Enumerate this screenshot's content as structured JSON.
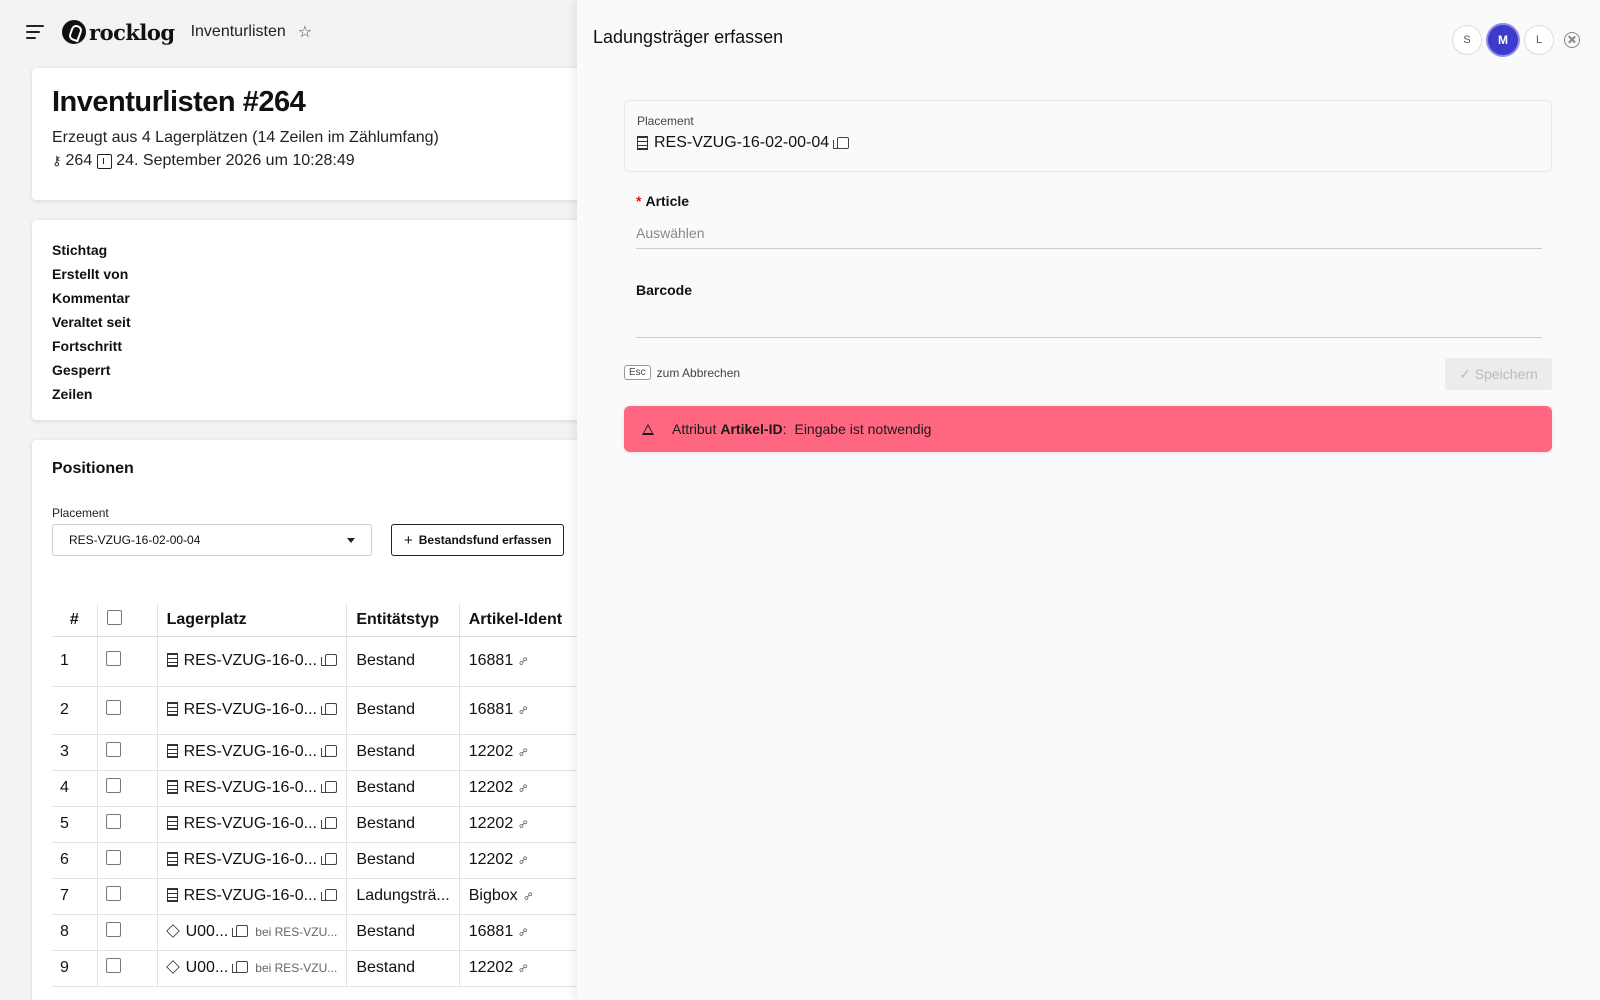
{
  "topbar": {
    "logo": "rocklog",
    "breadcrumb": "Inventurlisten"
  },
  "header": {
    "title": "Inventurlisten #264",
    "subtitle": "Erzeugt aus 4 Lagerplätzen (14 Zeilen im Zählumfang)",
    "id": "264",
    "date": "24. September 2026 um 10:28:49"
  },
  "details": {
    "labels": [
      "Stichtag",
      "Erstellt von",
      "Kommentar",
      "Veraltet seit",
      "Fortschritt",
      "Gesperrt",
      "Zeilen"
    ]
  },
  "positions": {
    "title": "Positionen",
    "filter_label": "Placement",
    "filter_value": "RES-VZUG-16-02-00-04",
    "add_button": "Bestandsfund erfassen",
    "columns": [
      "#",
      "",
      "Lagerplatz",
      "Entitätstyp",
      "Artikel-Ident"
    ],
    "rows": [
      {
        "n": "1",
        "place": "RES-VZUG-16-0...",
        "kind": "shelf",
        "bei": "",
        "type": "Bestand",
        "article": "16881"
      },
      {
        "n": "2",
        "place": "RES-VZUG-16-0...",
        "kind": "shelf",
        "bei": "",
        "type": "Bestand",
        "article": "16881"
      },
      {
        "n": "3",
        "place": "RES-VZUG-16-0...",
        "kind": "shelf",
        "bei": "",
        "type": "Bestand",
        "article": "12202"
      },
      {
        "n": "4",
        "place": "RES-VZUG-16-0...",
        "kind": "shelf",
        "bei": "",
        "type": "Bestand",
        "article": "12202"
      },
      {
        "n": "5",
        "place": "RES-VZUG-16-0...",
        "kind": "shelf",
        "bei": "",
        "type": "Bestand",
        "article": "12202"
      },
      {
        "n": "6",
        "place": "RES-VZUG-16-0...",
        "kind": "shelf",
        "bei": "",
        "type": "Bestand",
        "article": "12202"
      },
      {
        "n": "7",
        "place": "RES-VZUG-16-0...",
        "kind": "shelf",
        "bei": "",
        "type": "Ladungsträ...",
        "article": "Bigbox"
      },
      {
        "n": "8",
        "place": "U00...",
        "kind": "box",
        "bei": "bei RES-VZU...",
        "type": "Bestand",
        "article": "16881"
      },
      {
        "n": "9",
        "place": "U00...",
        "kind": "box",
        "bei": "bei RES-VZU...",
        "type": "Bestand",
        "article": "12202"
      }
    ]
  },
  "panel": {
    "title": "Ladungsträger erfassen",
    "sizes": [
      "S",
      "M",
      "L"
    ],
    "active_size": "M",
    "placement_label": "Placement",
    "placement_value": "RES-VZUG-16-02-00-04",
    "article_label": "Article",
    "article_placeholder": "Auswählen",
    "barcode_label": "Barcode",
    "esc_key": "Esc",
    "esc_hint": "zum Abbrechen",
    "save_label": "✓ Speichern",
    "alert": {
      "prefix": "Attribut",
      "field": "Artikel-ID",
      "colon": ":",
      "message": "Eingabe ist notwendig"
    }
  },
  "colors": {
    "accent": "#3d3bc9",
    "alert_bg": "#ff6780",
    "required": "#dd1111"
  }
}
